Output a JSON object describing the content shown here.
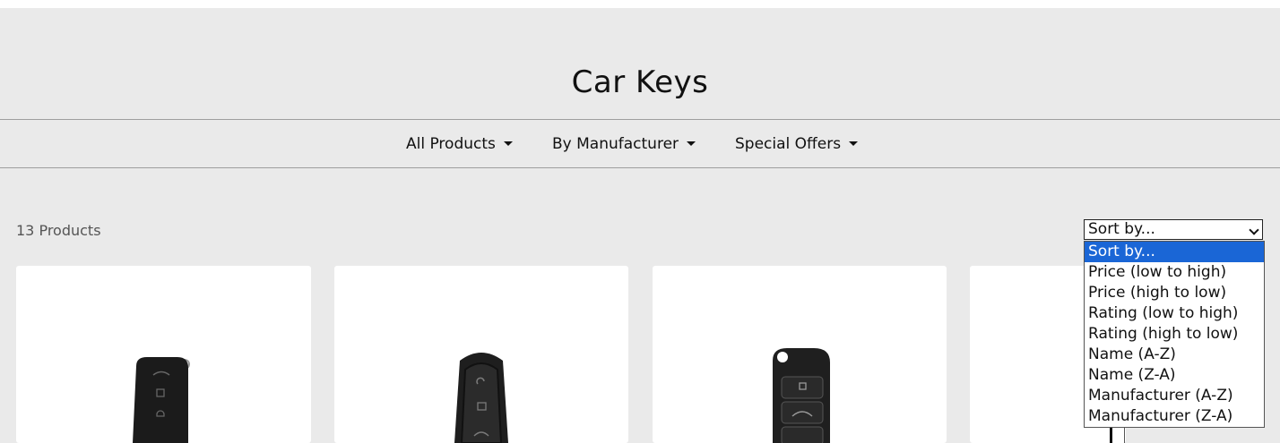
{
  "header": {
    "title": "Car Keys"
  },
  "nav": {
    "items": [
      {
        "label": "All Products"
      },
      {
        "label": "By Manufacturer"
      },
      {
        "label": "Special Offers"
      }
    ]
  },
  "listing": {
    "count_label": "13 Products",
    "sort": {
      "selected": "Sort by...",
      "options": [
        "Sort by...",
        "Price (low to high)",
        "Price (high to low)",
        "Rating (low to high)",
        "Rating (high to low)",
        "Name (A-Z)",
        "Name (Z-A)",
        "Manufacturer (A-Z)",
        "Manufacturer (Z-A)"
      ]
    }
  },
  "products": [
    {
      "image_icon": "flip-key-fob-icon"
    },
    {
      "image_icon": "smart-key-fob-icon"
    },
    {
      "image_icon": "flip-key-fob-icon"
    },
    {
      "image_icon": "key-fob-icon"
    }
  ],
  "colors": {
    "page_background": "#eaeaea",
    "card_background": "#ffffff",
    "selected_option": "#1a66d6"
  }
}
